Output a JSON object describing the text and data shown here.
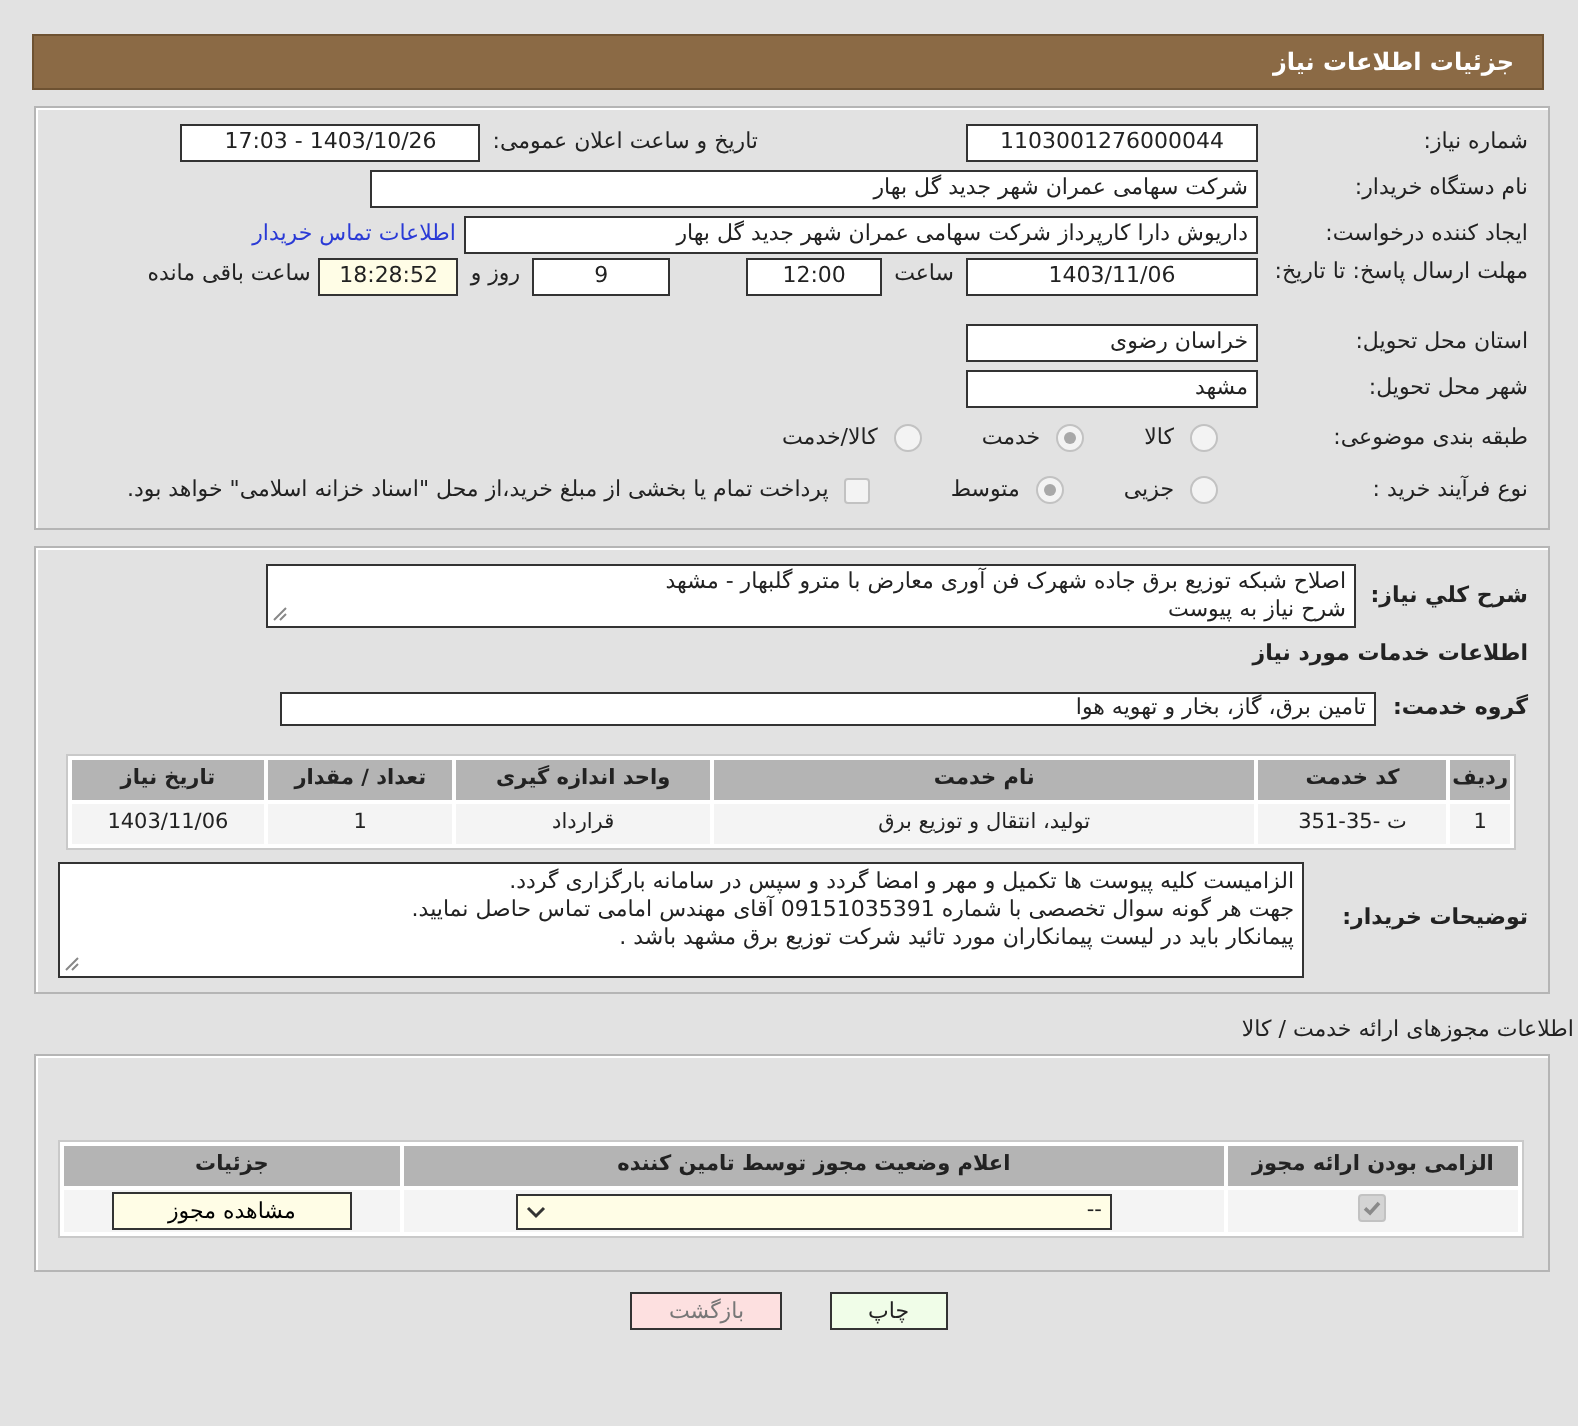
{
  "header": {
    "title": "جزئیات اطلاعات نیاز"
  },
  "need_number": {
    "label": "شماره نیاز:",
    "value": "1103001276000044"
  },
  "announce": {
    "label": "تاریخ و ساعت اعلان عمومی:",
    "value": "1403/10/26 - 17:03"
  },
  "buyer": {
    "label": "نام دستگاه خریدار:",
    "value": "شرکت سهامی عمران شهر جدید گل بهار"
  },
  "requester": {
    "label": "ایجاد کننده درخواست:",
    "value": "داریوش دارا کارپرداز شرکت سهامی عمران شهر جدید گل بهار",
    "link": "اطلاعات تماس خریدار"
  },
  "deadline": {
    "label": "مهلت ارسال پاسخ: تا تاریخ:",
    "date": "1403/11/06",
    "time_label": "ساعت",
    "time": "12:00",
    "days": "9",
    "days_label": "روز و",
    "remaining": "18:28:52",
    "remaining_label": "ساعت باقی مانده"
  },
  "province": {
    "label": "استان محل تحویل:",
    "value": "خراسان رضوی"
  },
  "city": {
    "label": "شهر محل تحویل:",
    "value": "مشهد"
  },
  "category": {
    "label": "طبقه بندی موضوعی:",
    "options": [
      {
        "label": "کالا",
        "selected": false
      },
      {
        "label": "خدمت",
        "selected": true
      },
      {
        "label": "کالا/خدمت",
        "selected": false
      }
    ]
  },
  "process": {
    "label": "نوع فرآیند خرید :",
    "options": [
      {
        "label": "جزیی",
        "selected": false
      },
      {
        "label": "متوسط",
        "selected": true
      }
    ],
    "payment": {
      "label": "پرداخت تمام یا بخشی از مبلغ خرید،از محل \"اسناد خزانه اسلامی\" خواهد بود.",
      "checked": false
    }
  },
  "description": {
    "label": "شرح کلي نياز:",
    "lines": [
      "اصلاح شبکه توزیع برق جاده شهرک فن آوری معارض با مترو گلبهار - مشهد",
      "شرح نیاز به پیوست"
    ]
  },
  "services_title": "اطلاعات خدمات مورد نیاز",
  "service_group": {
    "label": "گروه خدمت:",
    "value": "تامین برق، گاز، بخار و تهویه هوا"
  },
  "services_table": {
    "columns": [
      "ردیف",
      "کد خدمت",
      "نام خدمت",
      "واحد اندازه گیری",
      "تعداد / مقدار",
      "تاریخ نیاز"
    ],
    "rows": [
      [
        "1",
        "ت -35-351",
        "تولید، انتقال و توزیع برق",
        "قرارداد",
        "1",
        "1403/11/06"
      ]
    ]
  },
  "buyer_notes": {
    "label": "توضیحات خریدار:",
    "lines": [
      "الزامیست کلیه پیوست ها تکمیل و مهر و امضا گردد و سپس در سامانه بارگزاری گردد.",
      "جهت هر گونه سوال تخصصی با شماره 09151035391 آقای مهندس امامی تماس حاصل نمایید.",
      "پیمانکار باید در لیست پیمانکاران مورد تائید شرکت توزیع برق مشهد باشد ."
    ]
  },
  "licenses": {
    "title": "اطلاعات مجوزهای ارائه خدمت / کالا",
    "columns": [
      "الزامی بودن ارائه مجوز",
      "اعلام وضعیت مجوز توسط تامین کننده",
      "جزئیات"
    ],
    "rows": [
      {
        "required": true,
        "status": "--",
        "button": "مشاهده مجوز"
      }
    ]
  },
  "buttons": [
    {
      "label": "چاپ",
      "kind": "print"
    },
    {
      "label": "بازگشت",
      "kind": "back"
    }
  ]
}
